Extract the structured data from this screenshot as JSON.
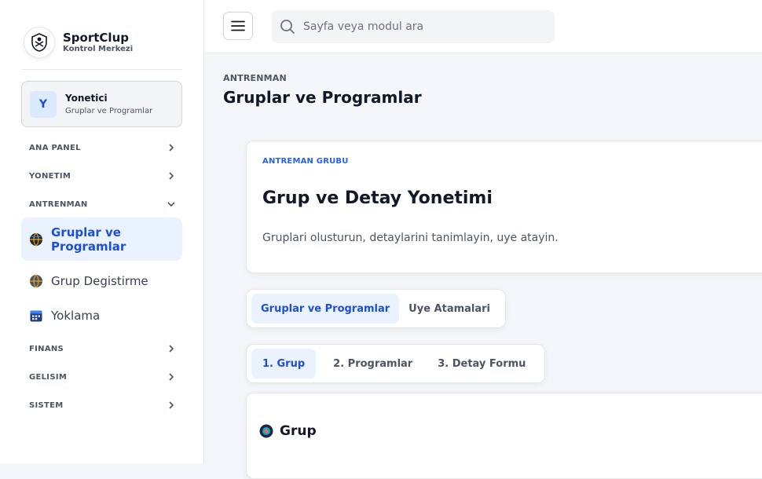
{
  "brand": {
    "name": "SportClup",
    "subtitle": "Kontrol Merkezi"
  },
  "user": {
    "initial": "Y",
    "name": "Yonetici",
    "role": "Gruplar ve Programlar"
  },
  "nav": {
    "sections": [
      {
        "label": "ANA PANEL",
        "expanded": false
      },
      {
        "label": "YONETIM",
        "expanded": false
      },
      {
        "label": "ANTRENMAN",
        "expanded": true
      },
      {
        "label": "FINANS",
        "expanded": false
      },
      {
        "label": "GELISIM",
        "expanded": false
      },
      {
        "label": "SISTEM",
        "expanded": false
      }
    ],
    "items": [
      {
        "label": "Gruplar ve Programlar",
        "icon": "globe-icon",
        "active": true
      },
      {
        "label": "Grup Degistirme",
        "icon": "globe-icon",
        "active": false
      },
      {
        "label": "Yoklama",
        "icon": "calendar-icon",
        "active": false
      }
    ]
  },
  "topbar": {
    "search_placeholder": "Sayfa veya modul ara"
  },
  "page": {
    "breadcrumb": "ANTRENMAN",
    "title": "Gruplar ve Programlar"
  },
  "hero": {
    "tag": "ANTREMAN GRUBU",
    "title": "Grup ve Detay Yonetimi",
    "description": "Gruplari olusturun, detaylarini tanimlayin, uye atayin."
  },
  "tabs_main": [
    {
      "label": "Gruplar ve Programlar",
      "active": true
    },
    {
      "label": "Uye Atamalari",
      "active": false
    }
  ],
  "tabs_steps": [
    {
      "label": "1. Grup",
      "active": true
    },
    {
      "label": "2. Programlar",
      "active": false
    },
    {
      "label": "3. Detay Formu",
      "active": false
    }
  ],
  "section": {
    "title": "Grup",
    "icon": "grup-icon"
  },
  "colors": {
    "accent": "#1d4ed8",
    "active_bg": "#eaf2fe",
    "tag": "#2563eb"
  }
}
